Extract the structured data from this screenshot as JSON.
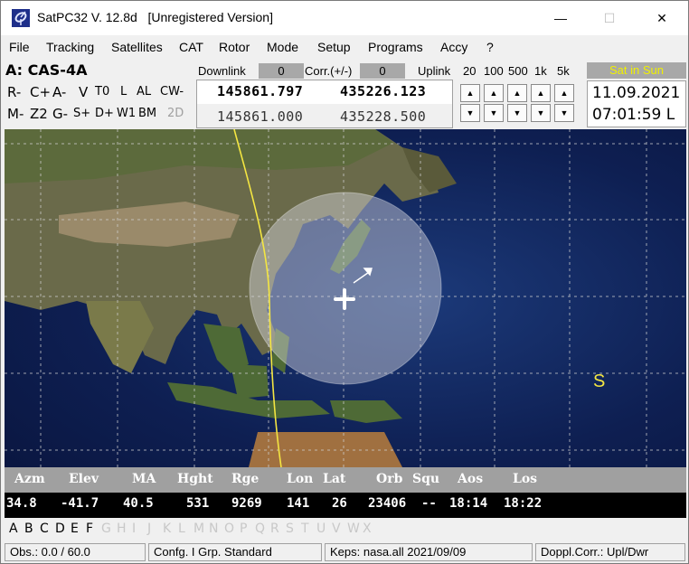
{
  "window": {
    "title": "SatPC32 V. 12.8d   [Unregistered Version]",
    "minimize_glyph": "—",
    "maximize_glyph": "☐",
    "close_glyph": "✕"
  },
  "menu": [
    "File",
    "Tracking",
    "Satellites",
    "CAT",
    "Rotor",
    "Mode",
    "Setup",
    "Programs",
    "Accy",
    "?"
  ],
  "panel": {
    "satellite": "A: CAS-4A",
    "downlink_label": "Downlink",
    "downlink_value": "0",
    "corr_label": "Corr.(+/-)",
    "corr_value": "0",
    "uplink_label": "Uplink",
    "steps": [
      "20",
      "100",
      "500",
      "1k",
      "5k"
    ],
    "controls_row1": [
      "R-",
      "C+",
      "A-",
      "V",
      "T0",
      "L",
      "AL",
      "CW-"
    ],
    "controls_row2": [
      "M-",
      "Z2",
      "G-",
      "S+",
      "D+",
      "W1",
      "BM",
      "2D"
    ],
    "freq_rx_top": "145861.797",
    "freq_tx_top": "435226.123",
    "freq_rx_bottom": "145861.000",
    "freq_tx_bottom": "435228.500",
    "sun_status": "Sat in Sun",
    "date": "11.09.2021",
    "time": "07:01:59 L"
  },
  "map": {
    "label_s": "S",
    "footprint_color": "#d8d8e0",
    "track_color": "#f4e642"
  },
  "databar": {
    "headers": [
      "Azm",
      "Elev",
      "MA",
      "Hght",
      "Rge",
      "Lon",
      "Lat",
      "Orb",
      "Squ",
      "Aos",
      "Los"
    ],
    "values": [
      "34.8",
      "-41.7",
      "40.5",
      "531",
      "9269",
      "141",
      "26",
      "23406",
      "--",
      "18:14",
      "18:22"
    ]
  },
  "letters": {
    "active": [
      "A",
      "B",
      "C",
      "D",
      "E",
      "F"
    ],
    "inactive": [
      "G",
      "H",
      "I",
      "J",
      "K",
      "L",
      "M",
      "N",
      "O",
      "P",
      "Q",
      "R",
      "S",
      "T",
      "U",
      "V",
      "W",
      "X"
    ]
  },
  "status": {
    "obs": "Obs.: 0.0 / 60.0",
    "config": "Confg. I  Grp. Standard",
    "keps": "Keps: nasa.all 2021/09/09",
    "doppler": "Doppl.Corr.: Upl/Dwr"
  }
}
